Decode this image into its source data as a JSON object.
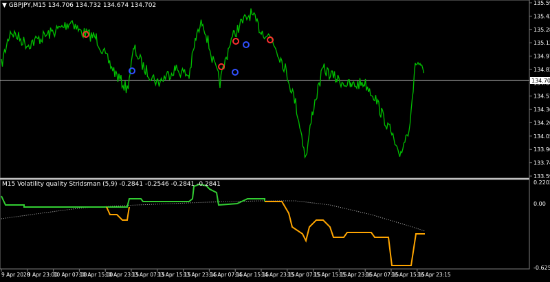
{
  "main_panel": {
    "symbol_header": "GBPJPY,M15  134.706 134.732 134.674 134.702",
    "price_line_label": "134.702",
    "y_ticks": [
      "135.590",
      "135.435",
      "135.280",
      "135.125",
      "134.975",
      "134.820",
      "134.665",
      "134.510",
      "134.360",
      "134.205",
      "134.050",
      "133.900",
      "133.745",
      "133.590"
    ],
    "series_color": "#00c000",
    "arrow_up_color": "#3050ff",
    "arrow_down_color": "#ff3030"
  },
  "indicator_panel": {
    "header": "M15 Volatility quality Stridsman (5,9) -0.2841 -0.2546 -0.2841 -0.2841",
    "y_ticks": [
      "0.2202",
      "0.00",
      "-0.625"
    ],
    "up_color": "#32cd32",
    "down_color": "#ffa500",
    "signal_color": "#c0c0c0"
  },
  "x_axis": {
    "labels": [
      "9 Apr 2020",
      "9 Apr 23:00",
      "10 Apr 07:00",
      "10 Apr 15:00",
      "10 Apr 23:15",
      "13 Apr 07:15",
      "13 Apr 15:15",
      "13 Apr 23:15",
      "14 Apr 07:15",
      "14 Apr 15:15",
      "14 Apr 23:15",
      "15 Apr 07:15",
      "15 Apr 15:15",
      "15 Apr 23:15",
      "16 Apr 07:15",
      "16 Apr 15:15",
      "16 Apr 23:15"
    ]
  }
}
